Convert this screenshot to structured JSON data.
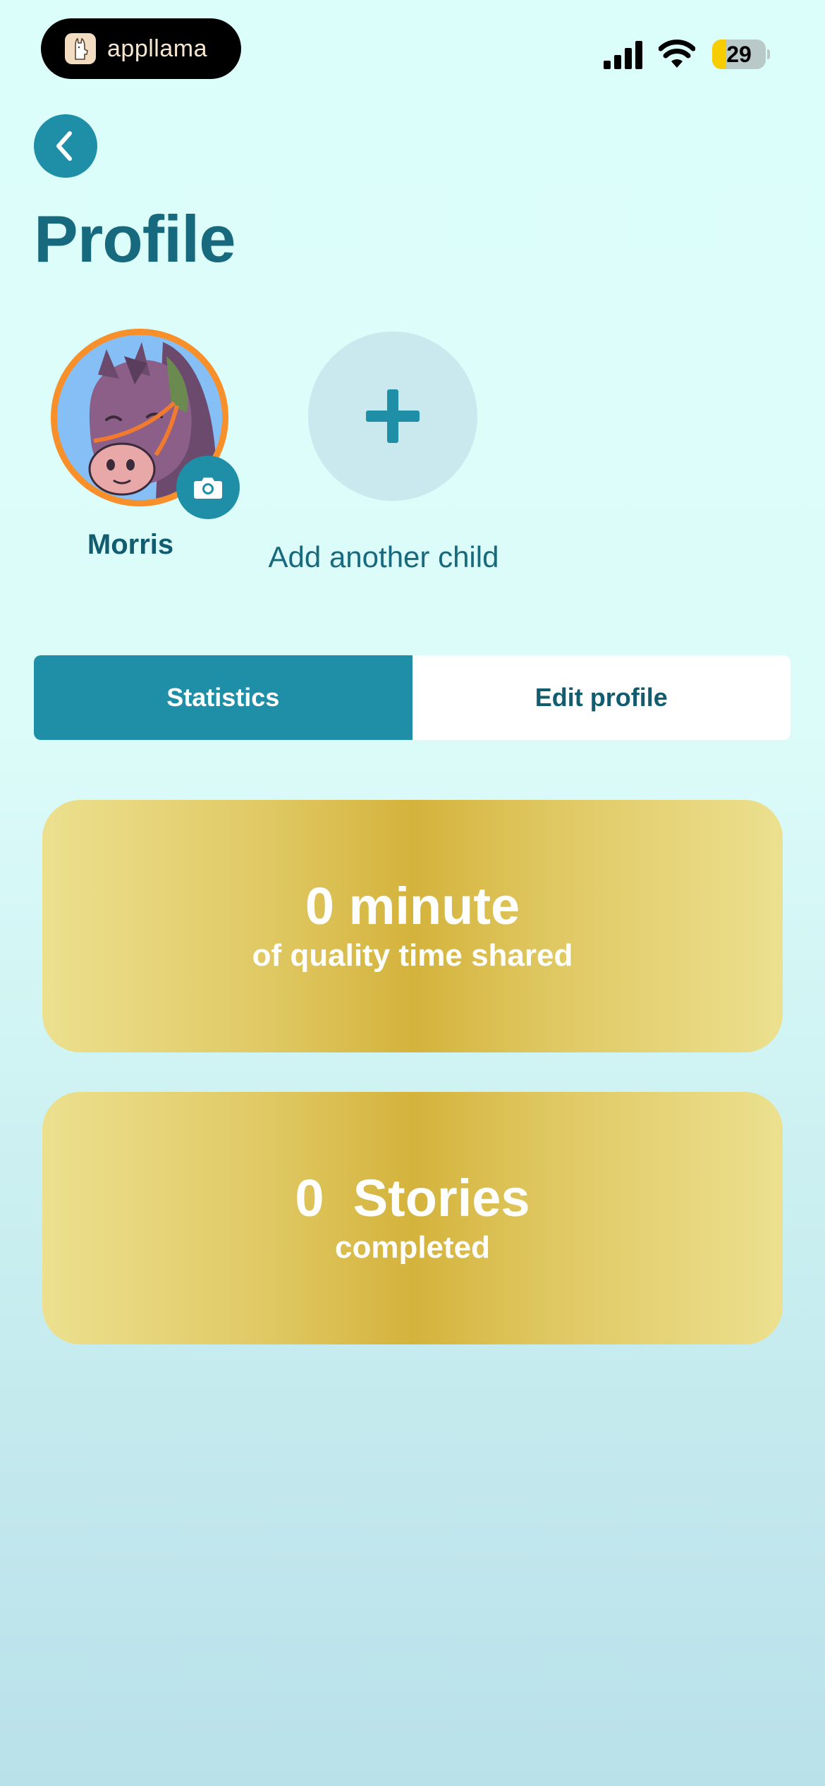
{
  "status_bar": {
    "app_name": "appllama",
    "battery": "29",
    "icons": [
      "llama-logo-icon",
      "cellular-signal-icon",
      "wifi-icon",
      "battery-icon"
    ]
  },
  "header": {
    "back_icon": "chevron-left-icon",
    "title": "Profile"
  },
  "children": [
    {
      "name": "Morris",
      "avatar_icon": "horse-avatar-icon",
      "camera_icon": "camera-icon"
    }
  ],
  "add_child": {
    "label": "Add another child",
    "icon": "plus-icon"
  },
  "tabs": [
    {
      "label": "Statistics",
      "active": true
    },
    {
      "label": "Edit profile",
      "active": false
    }
  ],
  "stats": [
    {
      "value": "0 minute",
      "caption": "of quality time shared"
    },
    {
      "value": "0  Stories",
      "caption": "completed"
    }
  ],
  "colors": {
    "accent": "#1f8fa8",
    "title": "#17697d",
    "avatar_ring": "#f7902a",
    "card_gold": "#d4b33c",
    "background_top": "#dcfefb",
    "background_bottom": "#b9e1ea"
  }
}
